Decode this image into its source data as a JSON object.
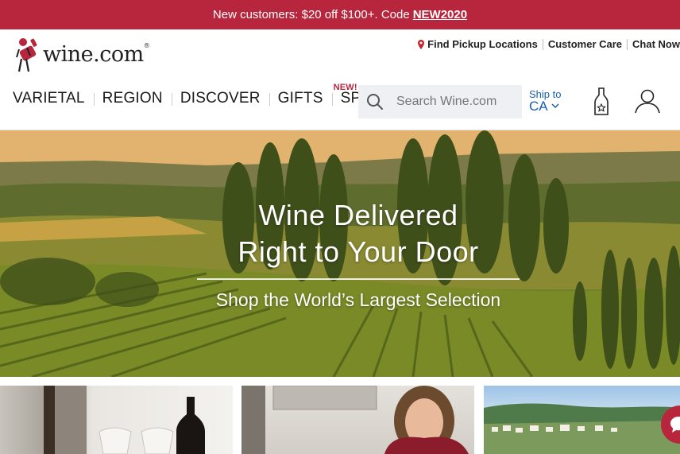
{
  "promo": {
    "text": "New customers: $20 off $100+. Code",
    "code": "NEW2020"
  },
  "brand": {
    "name": "wine.com",
    "mark": "®"
  },
  "utility": {
    "pickup": "Find Pickup Locations",
    "care": "Customer Care",
    "chat": "Chat Now"
  },
  "nav": {
    "items": [
      {
        "label": "VARIETAL"
      },
      {
        "label": "REGION"
      },
      {
        "label": "DISCOVER"
      },
      {
        "label": "GIFTS"
      },
      {
        "label": "SPIRITS",
        "badge": "NEW!"
      }
    ]
  },
  "search": {
    "placeholder": "Search Wine.com"
  },
  "shipping": {
    "label": "Ship to",
    "state": "CA"
  },
  "hero": {
    "line1": "Wine Delivered",
    "line2": "Right to Your Door",
    "subtitle": "Shop the World’s Largest Selection"
  },
  "icons": {
    "cellar": "wine-bottle-icon",
    "account": "account-icon",
    "chat": "chat-icon",
    "search": "search-icon",
    "pin": "location-pin-icon"
  },
  "colors": {
    "brand_red": "#b7263c",
    "link_blue": "#1a5fb4",
    "search_bg": "#eef0f3"
  }
}
